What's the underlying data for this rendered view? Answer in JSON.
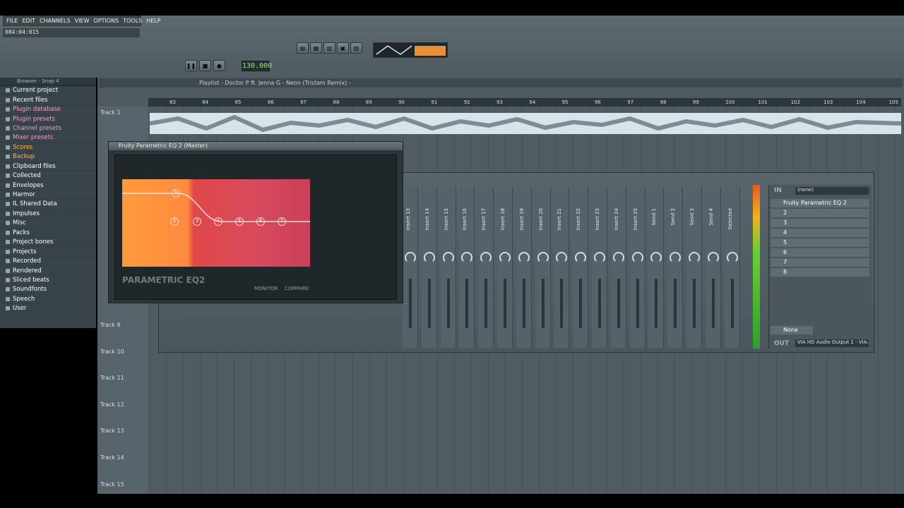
{
  "menu": [
    "FILE",
    "EDIT",
    "CHANNELS",
    "VIEW",
    "OPTIONS",
    "TOOLS",
    "HELP"
  ],
  "hint_bar": "084:04:015",
  "tempo": "130.000",
  "browser": {
    "title": "Browser - Snap 4",
    "items": [
      {
        "label": "Current project",
        "tone": "white"
      },
      {
        "label": "Recent files",
        "tone": "white"
      },
      {
        "label": "Plugin database",
        "tone": "pink"
      },
      {
        "label": "Plugin presets",
        "tone": "pink"
      },
      {
        "label": "Channel presets",
        "tone": "pink"
      },
      {
        "label": "Mixer presets",
        "tone": "pink"
      },
      {
        "label": "Scores",
        "tone": "orange"
      },
      {
        "label": "Backup",
        "tone": "orange"
      },
      {
        "label": "Clipboard files",
        "tone": "white"
      },
      {
        "label": "Collected",
        "tone": "white"
      },
      {
        "label": "Envelopes",
        "tone": "white"
      },
      {
        "label": "Harmor",
        "tone": "white"
      },
      {
        "label": "IL Shared Data",
        "tone": "white"
      },
      {
        "label": "Impulses",
        "tone": "white"
      },
      {
        "label": "Misc",
        "tone": "white"
      },
      {
        "label": "Packs",
        "tone": "white"
      },
      {
        "label": "Project bones",
        "tone": "white"
      },
      {
        "label": "Projects",
        "tone": "white"
      },
      {
        "label": "Recorded",
        "tone": "white"
      },
      {
        "label": "Rendered",
        "tone": "white"
      },
      {
        "label": "Sliced beats",
        "tone": "white"
      },
      {
        "label": "Soundfonts",
        "tone": "white"
      },
      {
        "label": "Speech",
        "tone": "white"
      },
      {
        "label": "User",
        "tone": "white"
      }
    ]
  },
  "playlist": {
    "title": "Playlist - Doctor P ft. Jenna G - Neon (Tristam Remix) -",
    "ruler": [
      "83",
      "84",
      "85",
      "86",
      "87",
      "88",
      "89",
      "90",
      "91",
      "92",
      "93",
      "94",
      "95",
      "96",
      "97",
      "98",
      "99",
      "100",
      "101",
      "102",
      "103",
      "104",
      "105"
    ],
    "tracks": [
      "Track 1",
      "Track 9",
      "Track 10",
      "Track 11",
      "Track 12",
      "Track 13",
      "Track 14",
      "Track 15"
    ]
  },
  "eq": {
    "title": "Fruity Parametric EQ 2 (Master)",
    "logo": "PARAMETRIC EQ2",
    "monitor": "MONITOR",
    "compare": "COMPARE",
    "bands": [
      "1",
      "2",
      "3",
      "4",
      "5",
      "6",
      "7"
    ]
  },
  "mixer": {
    "in_label": "IN",
    "in_value": "(none)",
    "out_label": "OUT",
    "out_value": "VIA HD Audio Output 1 - VIA.",
    "fx_slots": [
      "Fruity Parametric EQ 2",
      "2",
      "3",
      "4",
      "5",
      "6",
      "7",
      "8"
    ],
    "strips": [
      "Insert 13",
      "Insert 14",
      "Insert 15",
      "Insert 16",
      "Insert 17",
      "Insert 18",
      "Insert 19",
      "Insert 20",
      "Insert 21",
      "Insert 22",
      "Insert 23",
      "Insert 24",
      "Insert 25",
      "Send 1",
      "Send 2",
      "Send 3",
      "Send 4",
      "Selected"
    ],
    "none_label": "None"
  }
}
